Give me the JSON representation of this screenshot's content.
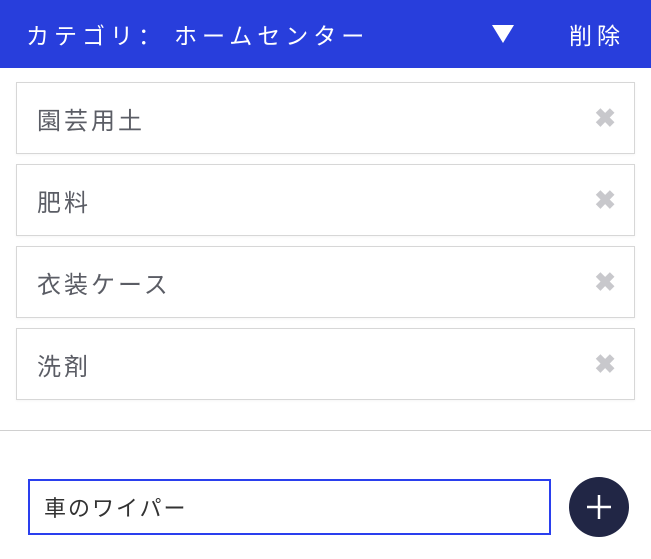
{
  "header": {
    "category_label": "カテゴリ：",
    "category_value": "ホームセンター",
    "delete_label": "削除"
  },
  "items": [
    {
      "label": "園芸用土"
    },
    {
      "label": "肥料"
    },
    {
      "label": "衣装ケース"
    },
    {
      "label": "洗剤"
    }
  ],
  "input": {
    "value": "車のワイパー"
  },
  "icons": {
    "close_glyph": "✖",
    "add": "add",
    "dropdown": "dropdown"
  },
  "colors": {
    "primary": "#283edc",
    "item_text": "#5b5d65",
    "close_icon": "#c8c8cc",
    "add_button": "#212645",
    "input_border": "#2a3fee"
  }
}
